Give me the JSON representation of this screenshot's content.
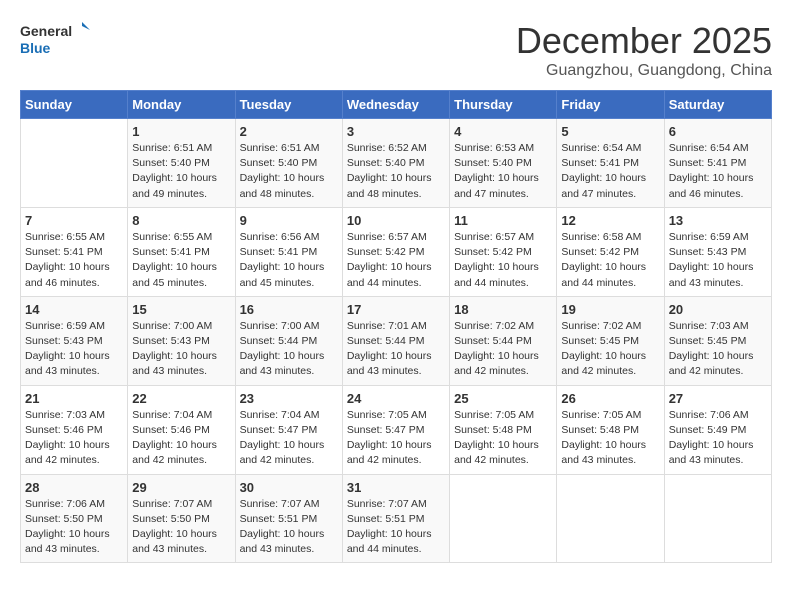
{
  "header": {
    "logo_general": "General",
    "logo_blue": "Blue",
    "month": "December 2025",
    "location": "Guangzhou, Guangdong, China"
  },
  "days_of_week": [
    "Sunday",
    "Monday",
    "Tuesday",
    "Wednesday",
    "Thursday",
    "Friday",
    "Saturday"
  ],
  "weeks": [
    [
      {
        "day": "",
        "info": ""
      },
      {
        "day": "1",
        "info": "Sunrise: 6:51 AM\nSunset: 5:40 PM\nDaylight: 10 hours\nand 49 minutes."
      },
      {
        "day": "2",
        "info": "Sunrise: 6:51 AM\nSunset: 5:40 PM\nDaylight: 10 hours\nand 48 minutes."
      },
      {
        "day": "3",
        "info": "Sunrise: 6:52 AM\nSunset: 5:40 PM\nDaylight: 10 hours\nand 48 minutes."
      },
      {
        "day": "4",
        "info": "Sunrise: 6:53 AM\nSunset: 5:40 PM\nDaylight: 10 hours\nand 47 minutes."
      },
      {
        "day": "5",
        "info": "Sunrise: 6:54 AM\nSunset: 5:41 PM\nDaylight: 10 hours\nand 47 minutes."
      },
      {
        "day": "6",
        "info": "Sunrise: 6:54 AM\nSunset: 5:41 PM\nDaylight: 10 hours\nand 46 minutes."
      }
    ],
    [
      {
        "day": "7",
        "info": "Sunrise: 6:55 AM\nSunset: 5:41 PM\nDaylight: 10 hours\nand 46 minutes."
      },
      {
        "day": "8",
        "info": "Sunrise: 6:55 AM\nSunset: 5:41 PM\nDaylight: 10 hours\nand 45 minutes."
      },
      {
        "day": "9",
        "info": "Sunrise: 6:56 AM\nSunset: 5:41 PM\nDaylight: 10 hours\nand 45 minutes."
      },
      {
        "day": "10",
        "info": "Sunrise: 6:57 AM\nSunset: 5:42 PM\nDaylight: 10 hours\nand 44 minutes."
      },
      {
        "day": "11",
        "info": "Sunrise: 6:57 AM\nSunset: 5:42 PM\nDaylight: 10 hours\nand 44 minutes."
      },
      {
        "day": "12",
        "info": "Sunrise: 6:58 AM\nSunset: 5:42 PM\nDaylight: 10 hours\nand 44 minutes."
      },
      {
        "day": "13",
        "info": "Sunrise: 6:59 AM\nSunset: 5:43 PM\nDaylight: 10 hours\nand 43 minutes."
      }
    ],
    [
      {
        "day": "14",
        "info": "Sunrise: 6:59 AM\nSunset: 5:43 PM\nDaylight: 10 hours\nand 43 minutes."
      },
      {
        "day": "15",
        "info": "Sunrise: 7:00 AM\nSunset: 5:43 PM\nDaylight: 10 hours\nand 43 minutes."
      },
      {
        "day": "16",
        "info": "Sunrise: 7:00 AM\nSunset: 5:44 PM\nDaylight: 10 hours\nand 43 minutes."
      },
      {
        "day": "17",
        "info": "Sunrise: 7:01 AM\nSunset: 5:44 PM\nDaylight: 10 hours\nand 43 minutes."
      },
      {
        "day": "18",
        "info": "Sunrise: 7:02 AM\nSunset: 5:44 PM\nDaylight: 10 hours\nand 42 minutes."
      },
      {
        "day": "19",
        "info": "Sunrise: 7:02 AM\nSunset: 5:45 PM\nDaylight: 10 hours\nand 42 minutes."
      },
      {
        "day": "20",
        "info": "Sunrise: 7:03 AM\nSunset: 5:45 PM\nDaylight: 10 hours\nand 42 minutes."
      }
    ],
    [
      {
        "day": "21",
        "info": "Sunrise: 7:03 AM\nSunset: 5:46 PM\nDaylight: 10 hours\nand 42 minutes."
      },
      {
        "day": "22",
        "info": "Sunrise: 7:04 AM\nSunset: 5:46 PM\nDaylight: 10 hours\nand 42 minutes."
      },
      {
        "day": "23",
        "info": "Sunrise: 7:04 AM\nSunset: 5:47 PM\nDaylight: 10 hours\nand 42 minutes."
      },
      {
        "day": "24",
        "info": "Sunrise: 7:05 AM\nSunset: 5:47 PM\nDaylight: 10 hours\nand 42 minutes."
      },
      {
        "day": "25",
        "info": "Sunrise: 7:05 AM\nSunset: 5:48 PM\nDaylight: 10 hours\nand 42 minutes."
      },
      {
        "day": "26",
        "info": "Sunrise: 7:05 AM\nSunset: 5:48 PM\nDaylight: 10 hours\nand 43 minutes."
      },
      {
        "day": "27",
        "info": "Sunrise: 7:06 AM\nSunset: 5:49 PM\nDaylight: 10 hours\nand 43 minutes."
      }
    ],
    [
      {
        "day": "28",
        "info": "Sunrise: 7:06 AM\nSunset: 5:50 PM\nDaylight: 10 hours\nand 43 minutes."
      },
      {
        "day": "29",
        "info": "Sunrise: 7:07 AM\nSunset: 5:50 PM\nDaylight: 10 hours\nand 43 minutes."
      },
      {
        "day": "30",
        "info": "Sunrise: 7:07 AM\nSunset: 5:51 PM\nDaylight: 10 hours\nand 43 minutes."
      },
      {
        "day": "31",
        "info": "Sunrise: 7:07 AM\nSunset: 5:51 PM\nDaylight: 10 hours\nand 44 minutes."
      },
      {
        "day": "",
        "info": ""
      },
      {
        "day": "",
        "info": ""
      },
      {
        "day": "",
        "info": ""
      }
    ]
  ]
}
